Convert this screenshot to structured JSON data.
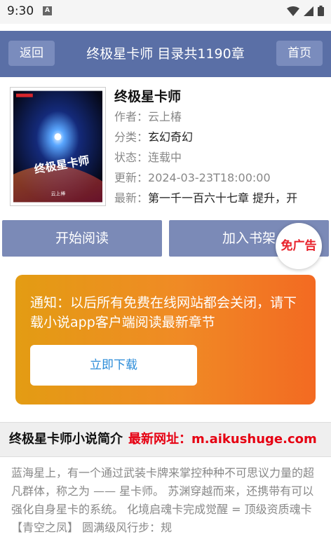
{
  "status_bar": {
    "time": "9:30",
    "notification_icon": "A"
  },
  "header": {
    "back_label": "返回",
    "title": "终极星卡师 目录共1190章",
    "home_label": "首页"
  },
  "book": {
    "title": "终极星卡师",
    "cover_title": "终极星卡师",
    "cover_author": "云上棒",
    "author_label": "作者：",
    "author": "云上椿",
    "category_label": "分类：",
    "category": "玄幻奇幻",
    "status_label": "状态：",
    "status": "连载中",
    "updated_label": "更新：",
    "updated": "2024-03-23T18:00:00",
    "latest_label": "最新：",
    "latest": "第一千一百六十七章 提升，开"
  },
  "actions": {
    "read_label": "开始阅读",
    "shelf_label": "加入书架",
    "noad_label": "免广告"
  },
  "notice": {
    "text": "通知：以后所有免费在线网站都会关闭，请下载小说app客户端阅读最新章节",
    "download_label": "立即下载"
  },
  "section": {
    "title": "终极星卡师小说简介",
    "url_label": "最新网址：m.aikushuge.com"
  },
  "intro": "蓝海星上，有一个通过武装卡牌来掌控种种不可思议力量的超凡群体，称之为 —— 星卡师。 苏渊穿越而来，还携带有可以强化自身星卡的系统。 化境启魂卡完成觉醒 = 顶级资质魂卡【青空之凤】 圆满级风行步：规",
  "colors": {
    "header": "#5a6fa6",
    "button": "#7b8ab7",
    "notice_start": "#e39c13",
    "notice_end": "#f36a22",
    "url": "#e60012"
  }
}
